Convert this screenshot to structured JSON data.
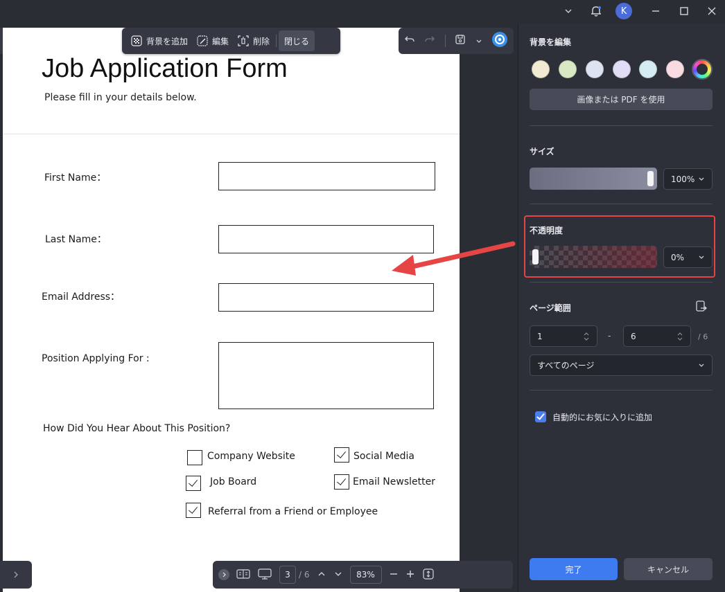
{
  "colors": {
    "panel_bg": "#2d3038",
    "accent": "#3f7bf0",
    "highlight": "#e64545",
    "arrow": "#e64545"
  },
  "titlebar": {
    "user_initial": "K"
  },
  "toolbar": {
    "add_background": "背景を追加",
    "edit": "編集",
    "delete": "削除",
    "close": "閉じる"
  },
  "document": {
    "title": "Job Application Form",
    "subtitle": "Please fill in your details below.",
    "fields": {
      "first_name": "First Name：",
      "last_name": "Last Name：",
      "email": "Email Address：",
      "position": "Position Applying For :"
    },
    "question": "How Did You Hear About This Position?",
    "options": [
      {
        "label": "Company Website",
        "checked": false
      },
      {
        "label": "Social Media",
        "checked": true
      },
      {
        "label": "Job Board",
        "checked": true
      },
      {
        "label": "Email Newsletter",
        "checked": true
      },
      {
        "label": "Referral from a Friend or Employee",
        "checked": true
      }
    ]
  },
  "panel": {
    "title": "背景を編集",
    "swatches": [
      "#f2ead2",
      "#d8e9c4",
      "#dde3f3",
      "#e2ddf6",
      "#d6ecf3",
      "#f9dbe2"
    ],
    "use_image_pdf": "画像または PDF を使用",
    "size_label": "サイズ",
    "size_value": "100%",
    "opacity_label": "不透明度",
    "opacity_value": "0%",
    "page_range_label": "ページ範囲",
    "range_from": "1",
    "range_dash": "-",
    "range_to": "6",
    "range_total": "/ 6",
    "pages_select": "すべてのページ",
    "auto_favorite": "自動的にお気に入りに追加",
    "done": "完了",
    "cancel": "キャンセル"
  },
  "bottombar": {
    "current_page": "3",
    "total_pages": "/ 6",
    "zoom": "83%"
  }
}
